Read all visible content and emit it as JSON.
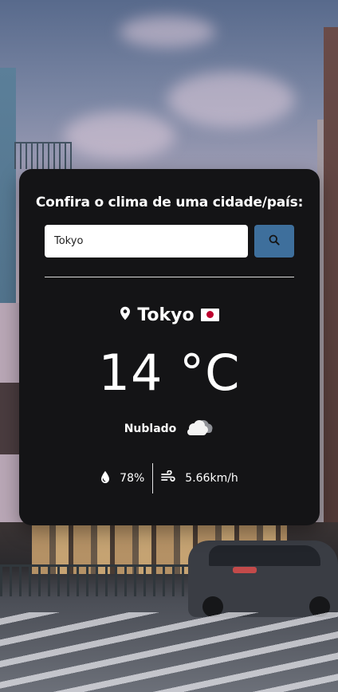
{
  "search": {
    "title": "Confira o clima de uma cidade/país:",
    "query": "Tokyo"
  },
  "weather": {
    "city": "Tokyo",
    "country_flag": "JP",
    "temperature": "14 °C",
    "description": "Nublado",
    "humidity": "78%",
    "wind": "5.66km/h"
  },
  "icons": {
    "search": "search-icon",
    "location": "location-pin-icon",
    "flag": "japan-flag-icon",
    "condition": "cloud-icon",
    "humidity": "water-drop-icon",
    "wind": "wind-icon"
  },
  "colors": {
    "card_background": "#141416",
    "search_button": "#3e6f9c",
    "text": "#ffffff"
  }
}
